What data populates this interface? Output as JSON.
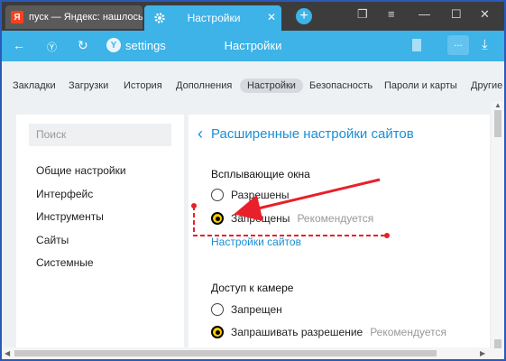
{
  "tabs": [
    {
      "title": "пуск — Яндекс: нашлось",
      "icon": "yandex-logo"
    },
    {
      "title": "Настройки",
      "icon": "gear-icon"
    }
  ],
  "window_controls": [
    "restore",
    "minimize",
    "maximize",
    "close"
  ],
  "addressbar": {
    "shield_glyph": "Y",
    "url": "settings",
    "title": "Настройки",
    "menu_glyph": "..."
  },
  "nav": {
    "items": [
      "Закладки",
      "Загрузки",
      "История",
      "Дополнения",
      "Настройки",
      "Безопасность",
      "Пароли и карты",
      "Другие"
    ],
    "active": "Настройки"
  },
  "sidebar": {
    "search_placeholder": "Поиск",
    "items": [
      "Общие настройки",
      "Интерфейс",
      "Инструменты",
      "Сайты",
      "Системные"
    ]
  },
  "main": {
    "title": "Расширенные настройки сайтов",
    "popups": {
      "title": "Всплывающие окна",
      "options": [
        {
          "label": "Разрешены",
          "checked": false,
          "note": ""
        },
        {
          "label": "Запрещены",
          "checked": true,
          "note": "Рекомендуется"
        }
      ],
      "link": "Настройки сайтов"
    },
    "camera": {
      "title": "Доступ к камере",
      "options": [
        {
          "label": "Запрещен",
          "checked": false,
          "note": ""
        },
        {
          "label": "Запрашивать разрешение",
          "checked": true,
          "note": "Рекомендуется"
        }
      ]
    }
  },
  "annotation_color": "#e8202a",
  "accent_color": "#3db3e8"
}
